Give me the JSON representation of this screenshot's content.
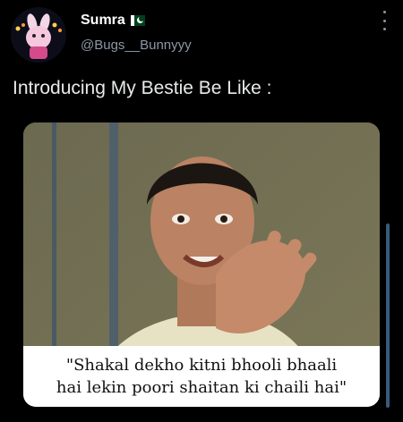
{
  "author": {
    "display_name": "Sumra",
    "handle": "@Bugs__Bunnyyy",
    "flag_icon": "pakistan-flag-icon"
  },
  "tweet": {
    "text": "Introducing My Bestie Be Like :"
  },
  "media": {
    "caption_line1": "\"Shakal dekho kitni bhooli bhaali",
    "caption_line2": "hai lekin poori shaitan ki chaili hai\""
  },
  "icons": {
    "more": "more-options-icon",
    "avatar": "avatar"
  },
  "colors": {
    "background": "#000000",
    "text_primary": "#e7e9ea",
    "text_secondary": "#8b98a5",
    "flag_green": "#01411c"
  }
}
